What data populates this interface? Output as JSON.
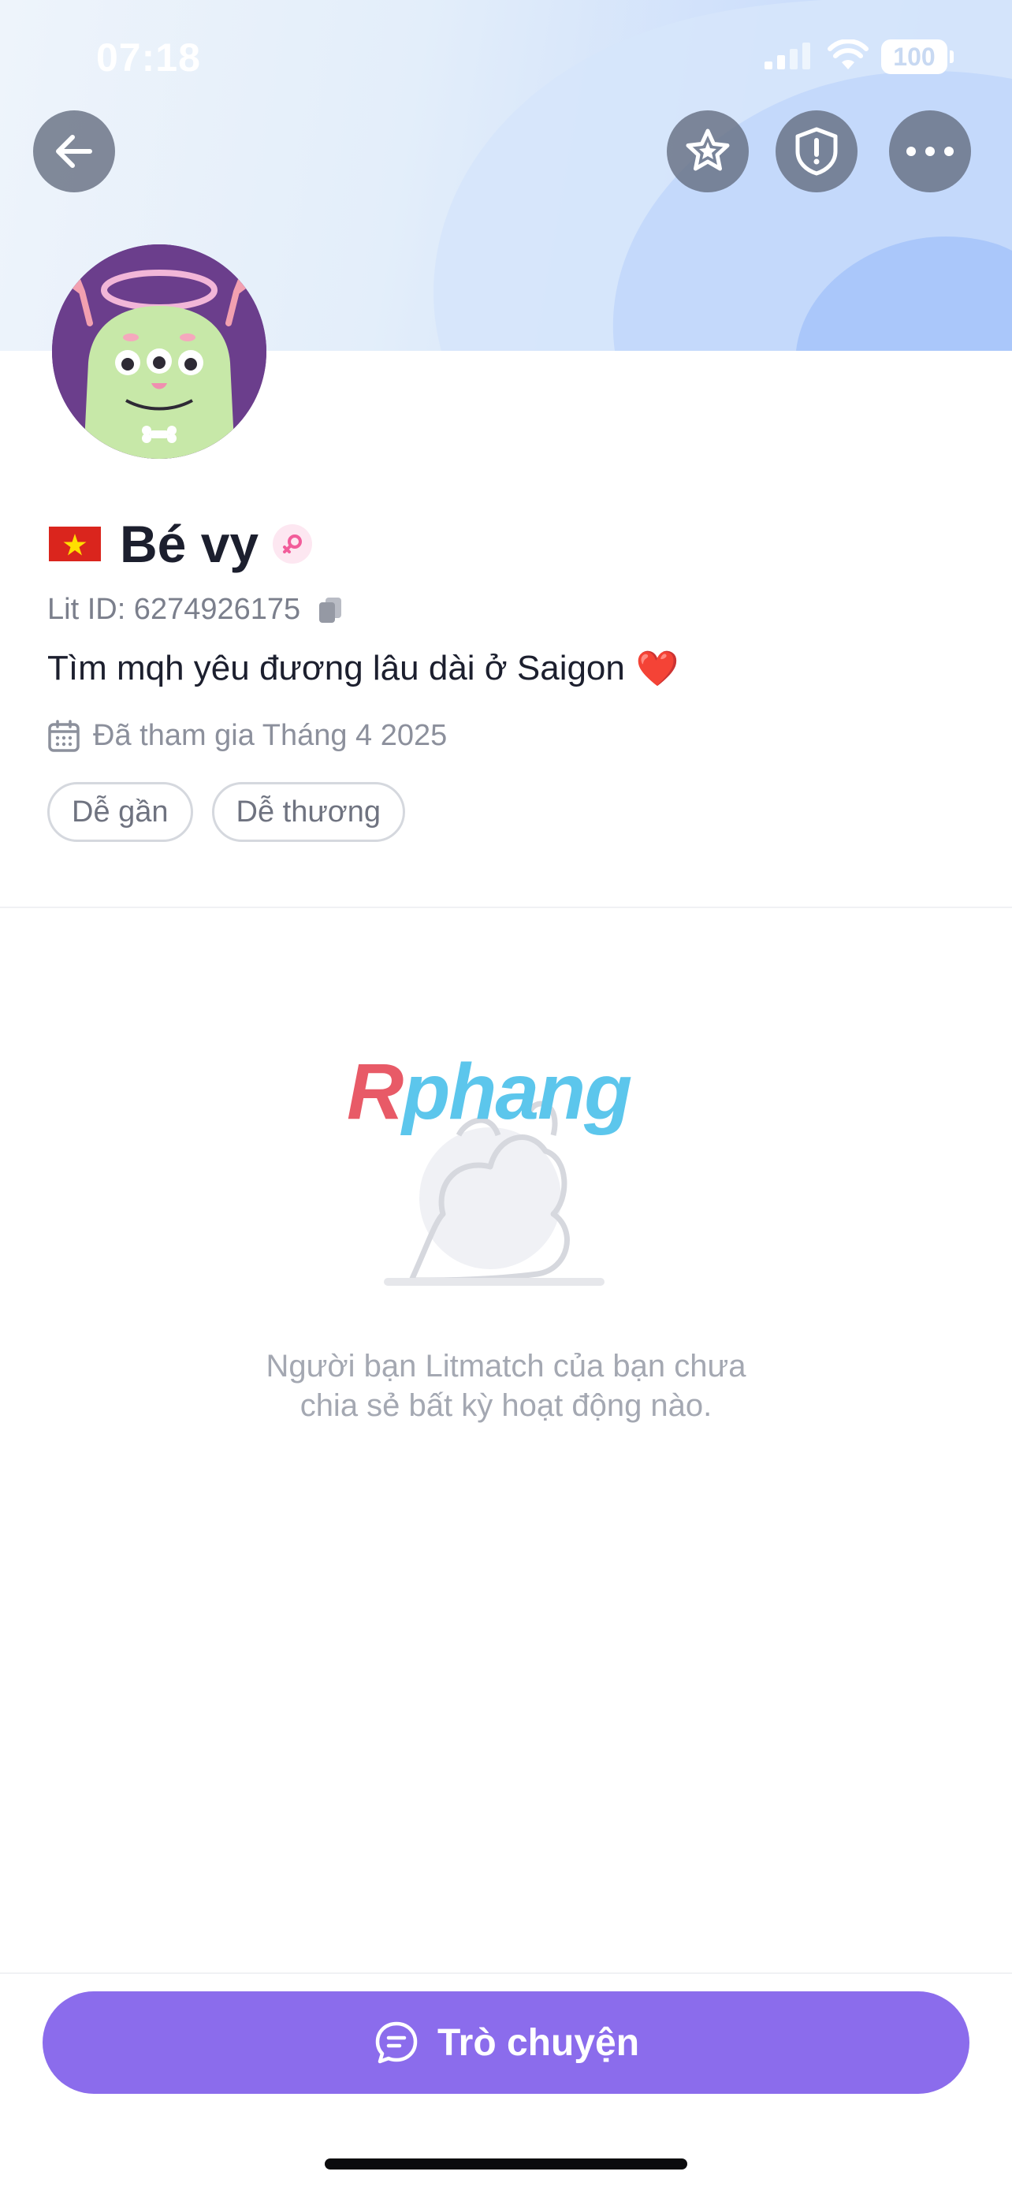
{
  "status_bar": {
    "time": "07:18",
    "battery": "100",
    "icons": [
      "signal-icon",
      "wifi-icon",
      "battery-icon"
    ]
  },
  "header": {
    "back_icon": "arrow-left-icon",
    "actions": [
      "star-icon",
      "shield-alert-icon",
      "more-horizontal-icon"
    ]
  },
  "profile": {
    "flag": "vietnam-flag-icon",
    "name": "Bé vy",
    "gender_icon": "female-icon",
    "lit_id": "Lit ID: 6274926175",
    "bio": "Tìm mqh yêu đương lâu dài ở Saigon",
    "bio_emoji": "❤️",
    "joined": "Đã tham gia Tháng 4 2025",
    "tags": [
      "Dễ gần",
      "Dễ thương"
    ]
  },
  "watermark": {
    "first_letter": "R",
    "rest": "phang"
  },
  "empty_state": {
    "line1": "Người bạn Litmatch của bạn chưa",
    "line2": "chia sẻ bất kỳ hoạt động nào."
  },
  "bottom": {
    "chat_label": "Trò chuyện"
  },
  "colors": {
    "accent": "#8b6cec",
    "text_primary": "#1c1f2e",
    "text_secondary": "#8c909c",
    "banner": "#cfe0fb"
  }
}
